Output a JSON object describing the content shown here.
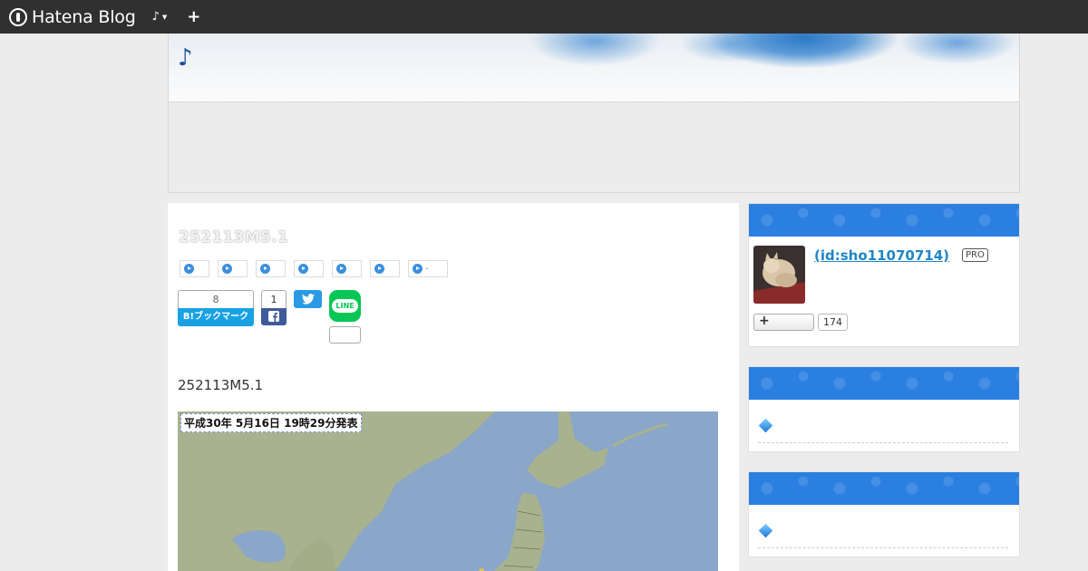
{
  "topbar": {
    "brand": "Hatena Blog",
    "blog_menu_label": "♪",
    "plus_label": "+"
  },
  "header": {
    "title": "♪"
  },
  "entry": {
    "title": "252113M5.1",
    "categories": [
      "",
      "",
      "",
      "",
      "",
      "",
      "-"
    ],
    "bookmark_count": "8",
    "bookmark_label": "B!ブックマーク",
    "facebook_count": "1",
    "facebook_label": "f",
    "body_text": "252113M5.1",
    "map_caption": "平成30年 5月16日 19時29分発表"
  },
  "sidebar": {
    "profile": {
      "id_text": " (id:sho11070714)",
      "badge": "PRO",
      "follow_label": "+",
      "follower_count": "174"
    }
  },
  "colors": {
    "topbar_bg": "#303030",
    "sidebar_header": "#2b7fe0",
    "hatena_bookmark": "#18a1e3",
    "facebook": "#3f5b9b",
    "twitter": "#2b9ae5",
    "line": "#06c755"
  }
}
